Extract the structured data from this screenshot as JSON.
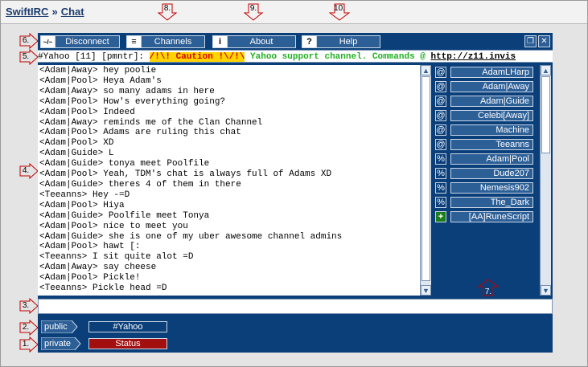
{
  "breadcrumb": {
    "site": "SwiftIRC",
    "separator": "»",
    "page": "Chat"
  },
  "callouts": [
    "1.",
    "2.",
    "3.",
    "4.",
    "5.",
    "6.",
    "7.",
    "8.",
    "9.",
    "10."
  ],
  "toolbar": {
    "disconnect": {
      "label": "Disconnect",
      "icon": "~/~"
    },
    "channels": {
      "label": "Channels",
      "icon": "≡"
    },
    "about": {
      "label": "About",
      "icon": "i"
    },
    "help": {
      "label": "Help",
      "icon": "?"
    },
    "restore": "❐",
    "close": "✕"
  },
  "topic": {
    "prefix": "#Yahoo [11] [pmntr]: ",
    "caution": "/!\\!  Caution !\\/!\\",
    "message": " Yahoo support channel. Commands @ ",
    "link": "http://z11.invis"
  },
  "chat_lines": [
    "<Adam|Away> hey poolie",
    "<Adam|Pool> Heya Adam's",
    "<Adam|Away> so many adams in here",
    "<Adam|Pool> How's everything going?",
    "<Adam|Pool> Indeed",
    "<Adam|Away> reminds me of the Clan Channel",
    "<Adam|Pool> Adams are ruling this chat",
    "<Adam|Pool> XD",
    "<Adam|Guide> L",
    "<Adam|Guide> tonya meet Poolfile",
    "<Adam|Pool> Yeah, TDM's chat is always full of Adams XD",
    "<Adam|Guide> theres 4 of them in there",
    "<Teeanns> Hey -=D",
    "<Adam|Pool> Hiya",
    "<Adam|Guide> Poolfile meet Tonya",
    "<Adam|Pool> nice to meet you",
    "<Adam|Guide> she is one of my uber awesome channel admins",
    "<Adam|Pool> hawt [:",
    "<Teeanns> I sit quite alot =D",
    "<Adam|Away> say cheese",
    "<Adam|Pool> Pickle!",
    "<Teeanns> Pickle head =D"
  ],
  "users": [
    {
      "mode": "@",
      "nick": "AdamLHarp"
    },
    {
      "mode": "@",
      "nick": "Adam|Away"
    },
    {
      "mode": "@",
      "nick": "Adam|Guide"
    },
    {
      "mode": "@",
      "nick": "Celebi[Away]"
    },
    {
      "mode": "@",
      "nick": "Machine"
    },
    {
      "mode": "@",
      "nick": "Teeanns"
    },
    {
      "mode": "%",
      "nick": "Adam|Pool"
    },
    {
      "mode": "%",
      "nick": "Dude207"
    },
    {
      "mode": "%",
      "nick": "Nemesis902"
    },
    {
      "mode": "%",
      "nick": "The_Dark"
    },
    {
      "mode": "+",
      "nick": "[AA]RuneScript"
    }
  ],
  "input": {
    "value": "",
    "placeholder": ""
  },
  "tabs": {
    "public_label": "public",
    "public_tab": "#Yahoo",
    "private_label": "private",
    "private_tab": "Status"
  },
  "colors": {
    "app_bg": "#0a3f7a",
    "button_bg": "#2d5f97",
    "caution_red": "#d40000",
    "caution_yellow": "#ffd400",
    "topic_green": "#22b022",
    "status_tab": "#a30f0f",
    "callout_red": "#c00000"
  }
}
